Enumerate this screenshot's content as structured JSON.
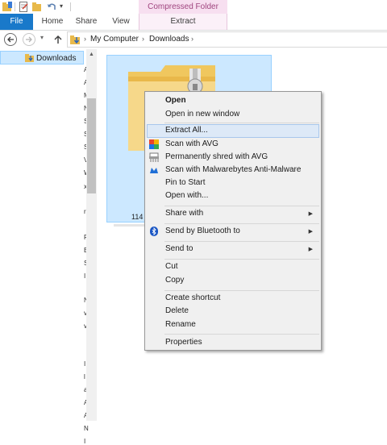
{
  "ribbon": {
    "contextual_group": "Compressed Folder Tools",
    "tabs": [
      "File",
      "Home",
      "Share",
      "View",
      "Extract"
    ]
  },
  "addressbar": {
    "crumbs": [
      "My Computer",
      "Downloads"
    ]
  },
  "navpane": {
    "selected_item": "Downloads",
    "fragments": [
      "A",
      "A",
      "M",
      "N",
      "S",
      "S",
      "S",
      "V",
      "W",
      "x",
      "r",
      "P",
      "E",
      "S",
      "I",
      "N",
      "v",
      "v",
      "I",
      "l",
      "a",
      "A",
      "A",
      "N",
      "I"
    ]
  },
  "content": {
    "file_name_fragment": "114"
  },
  "context_menu": {
    "items": [
      {
        "label": "Open",
        "bold": true
      },
      {
        "label": "Open in new window"
      },
      {
        "label": "Extract All..."
      },
      {
        "label": "Scan with AVG",
        "icon": "avg-icon"
      },
      {
        "label": "Permanently shred with AVG",
        "icon": "shredder-icon"
      },
      {
        "label": "Scan with Malwarebytes Anti-Malware",
        "icon": "malwarebytes-icon"
      },
      {
        "label": "Pin to Start"
      },
      {
        "label": "Open with..."
      },
      {
        "label": "Share with"
      },
      {
        "label": "Send by Bluetooth to",
        "icon": "bluetooth-icon"
      },
      {
        "label": "Send to"
      },
      {
        "label": "Cut"
      },
      {
        "label": "Copy"
      },
      {
        "label": "Create shortcut"
      },
      {
        "label": "Delete"
      },
      {
        "label": "Rename"
      },
      {
        "label": "Properties"
      }
    ]
  },
  "colors": {
    "file_tab": "#1979ca",
    "contextual_tab": "#f7dff0",
    "selection": "#cce8ff",
    "menu_highlight": "#dde9f7"
  }
}
